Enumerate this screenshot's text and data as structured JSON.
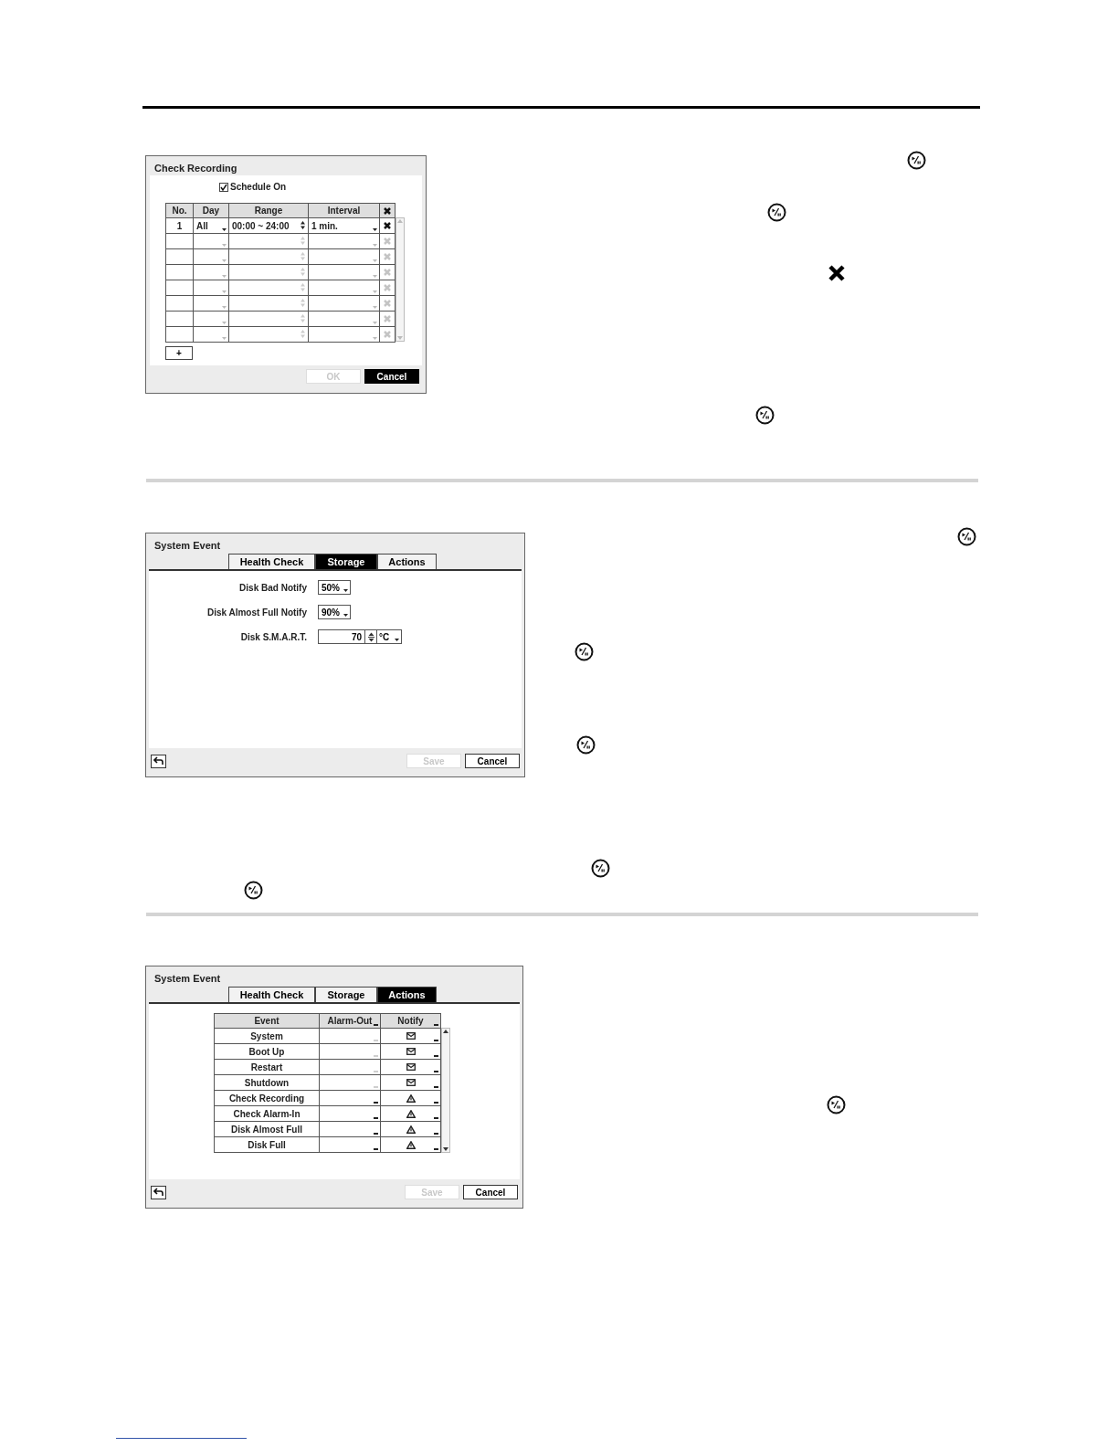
{
  "check_recording": {
    "title": "Check Recording",
    "schedule": {
      "label": "Schedule On",
      "checked": true
    },
    "columns": [
      "No.",
      "Day",
      "Range",
      "Interval"
    ],
    "rows": [
      {
        "no": "1",
        "day": "All",
        "range": "00:00 ~ 24:00",
        "interval": "1 min.",
        "enabled": true
      },
      {
        "enabled": false
      },
      {
        "enabled": false
      },
      {
        "enabled": false
      },
      {
        "enabled": false
      },
      {
        "enabled": false
      },
      {
        "enabled": false
      },
      {
        "enabled": false
      }
    ],
    "add_button": "+",
    "buttons": [
      {
        "label": "OK",
        "disabled": true,
        "focused": false
      },
      {
        "label": "Cancel",
        "disabled": false,
        "focused": true
      }
    ]
  },
  "storage_dialog": {
    "title": "System Event",
    "tabs": [
      {
        "label": "Health Check",
        "selected": false
      },
      {
        "label": "Storage",
        "selected": true
      },
      {
        "label": "Actions",
        "selected": false
      }
    ],
    "fields": [
      {
        "label": "Disk Bad Notify",
        "kind": "dropdown",
        "value": "50%"
      },
      {
        "label": "Disk Almost Full Notify",
        "kind": "dropdown",
        "value": "90%"
      },
      {
        "label": "Disk S.M.A.R.T.",
        "kind": "spinner",
        "value": "70",
        "unit": "°C"
      }
    ],
    "buttons": [
      {
        "label": "Save",
        "disabled": true,
        "focused": false
      },
      {
        "label": "Cancel",
        "disabled": false,
        "focused": false
      }
    ]
  },
  "actions_dialog": {
    "title": "System Event",
    "tabs": [
      {
        "label": "Health Check",
        "selected": false
      },
      {
        "label": "Storage",
        "selected": false
      },
      {
        "label": "Actions",
        "selected": true
      }
    ],
    "columns": [
      "Event",
      "Alarm-Out",
      "Notify"
    ],
    "rows": [
      {
        "event": "System",
        "alarm_out_enabled": false,
        "kind": "mail"
      },
      {
        "event": "Boot Up",
        "alarm_out_enabled": false,
        "kind": "mail"
      },
      {
        "event": "Restart",
        "alarm_out_enabled": false,
        "kind": "mail"
      },
      {
        "event": "Shutdown",
        "alarm_out_enabled": false,
        "kind": "mail"
      },
      {
        "event": "Check Recording",
        "alarm_out_enabled": true,
        "kind": "warning"
      },
      {
        "event": "Check Alarm-In",
        "alarm_out_enabled": true,
        "kind": "warning"
      },
      {
        "event": "Disk Almost Full",
        "alarm_out_enabled": true,
        "kind": "warning"
      },
      {
        "event": "Disk Full",
        "alarm_out_enabled": true,
        "kind": "warning"
      }
    ],
    "buttons": [
      {
        "label": "Save",
        "disabled": true,
        "focused": false
      },
      {
        "label": "Cancel",
        "disabled": false,
        "focused": false
      }
    ]
  }
}
